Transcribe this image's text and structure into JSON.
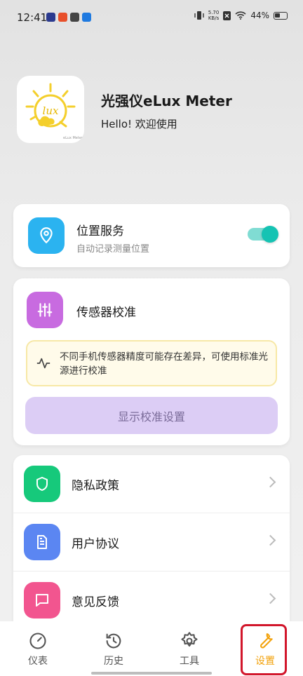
{
  "status_bar": {
    "time": "12:41",
    "net_speed_value": "5.70",
    "net_speed_unit": "KB/s",
    "battery": "44%"
  },
  "header": {
    "title": "光强仪eLux Meter",
    "subtitle": "Hello! 欢迎使用",
    "logo_text": "lux",
    "logo_caption": "eLux Meter"
  },
  "location": {
    "title": "位置服务",
    "subtitle": "自动记录测量位置",
    "enabled": true
  },
  "calibration": {
    "title": "传感器校准",
    "tip": "不同手机传感器精度可能存在差异，可使用标准光源进行校准",
    "button": "显示校准设置"
  },
  "menu": [
    {
      "label": "隐私政策",
      "icon": "shield-icon",
      "color": "#16c97b"
    },
    {
      "label": "用户协议",
      "icon": "document-icon",
      "color": "#5b86f2"
    },
    {
      "label": "意见反馈",
      "icon": "message-icon",
      "color": "#f2558f"
    }
  ],
  "nav": [
    {
      "label": "仪表",
      "icon": "gauge-icon"
    },
    {
      "label": "历史",
      "icon": "history-icon"
    },
    {
      "label": "工具",
      "icon": "gear-icon"
    },
    {
      "label": "设置",
      "icon": "wrench-icon",
      "active": true
    }
  ],
  "colors": {
    "accent": "#f2a20c",
    "toggle_on": "#15c3b3",
    "location_icon_bg": "#2bb3f0",
    "calibration_icon_bg": "#c86be0",
    "calibration_button_bg": "#dccdf5",
    "highlight_box": "#d2162b"
  }
}
